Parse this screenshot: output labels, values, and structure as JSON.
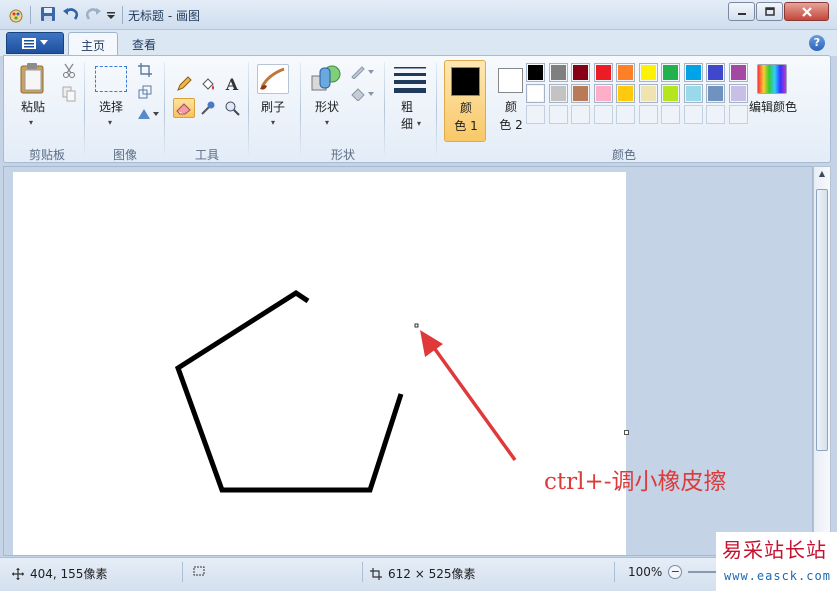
{
  "window": {
    "title": "无标题 - 画图"
  },
  "ribbon": {
    "tabs": [
      {
        "label": "主页",
        "active": true
      },
      {
        "label": "查看",
        "active": false
      }
    ],
    "groups": {
      "clipboard": {
        "label": "剪贴板",
        "paste": "粘贴"
      },
      "image": {
        "label": "图像",
        "select": "选择"
      },
      "tools": {
        "label": "工具"
      },
      "brushes": {
        "label": "刷子"
      },
      "shapes": {
        "label": "形状",
        "shapes_btn": "形状",
        "thickness_1": "粗",
        "thickness_2": "细"
      },
      "colors": {
        "label": "颜色",
        "color1_a": "颜",
        "color1_b": "色 1",
        "color2_a": "颜",
        "color2_b": "色 2",
        "edit": "编辑颜色",
        "palette_row1": [
          "#000000",
          "#7f7f7f",
          "#880015",
          "#ed1c24",
          "#ff7f27",
          "#fff200",
          "#22b14c",
          "#00a2e8",
          "#3f48cc",
          "#a349a4"
        ],
        "palette_row2": [
          "#ffffff",
          "#c3c3c3",
          "#b97a57",
          "#ffaec9",
          "#ffc90e",
          "#efe4b0",
          "#b5e61d",
          "#99d9ea",
          "#7092be",
          "#c8bfe7"
        ]
      }
    }
  },
  "annotation": "ctrl+-调小橡皮擦",
  "status": {
    "cursor": "404, 155像素",
    "size": "612 × 525像素",
    "zoom": "100%"
  },
  "watermark": {
    "title": "易采站长站",
    "url": "www.easck.com"
  },
  "colors": {
    "accent": "#1e4f9d",
    "arrow": "#e0393a"
  }
}
